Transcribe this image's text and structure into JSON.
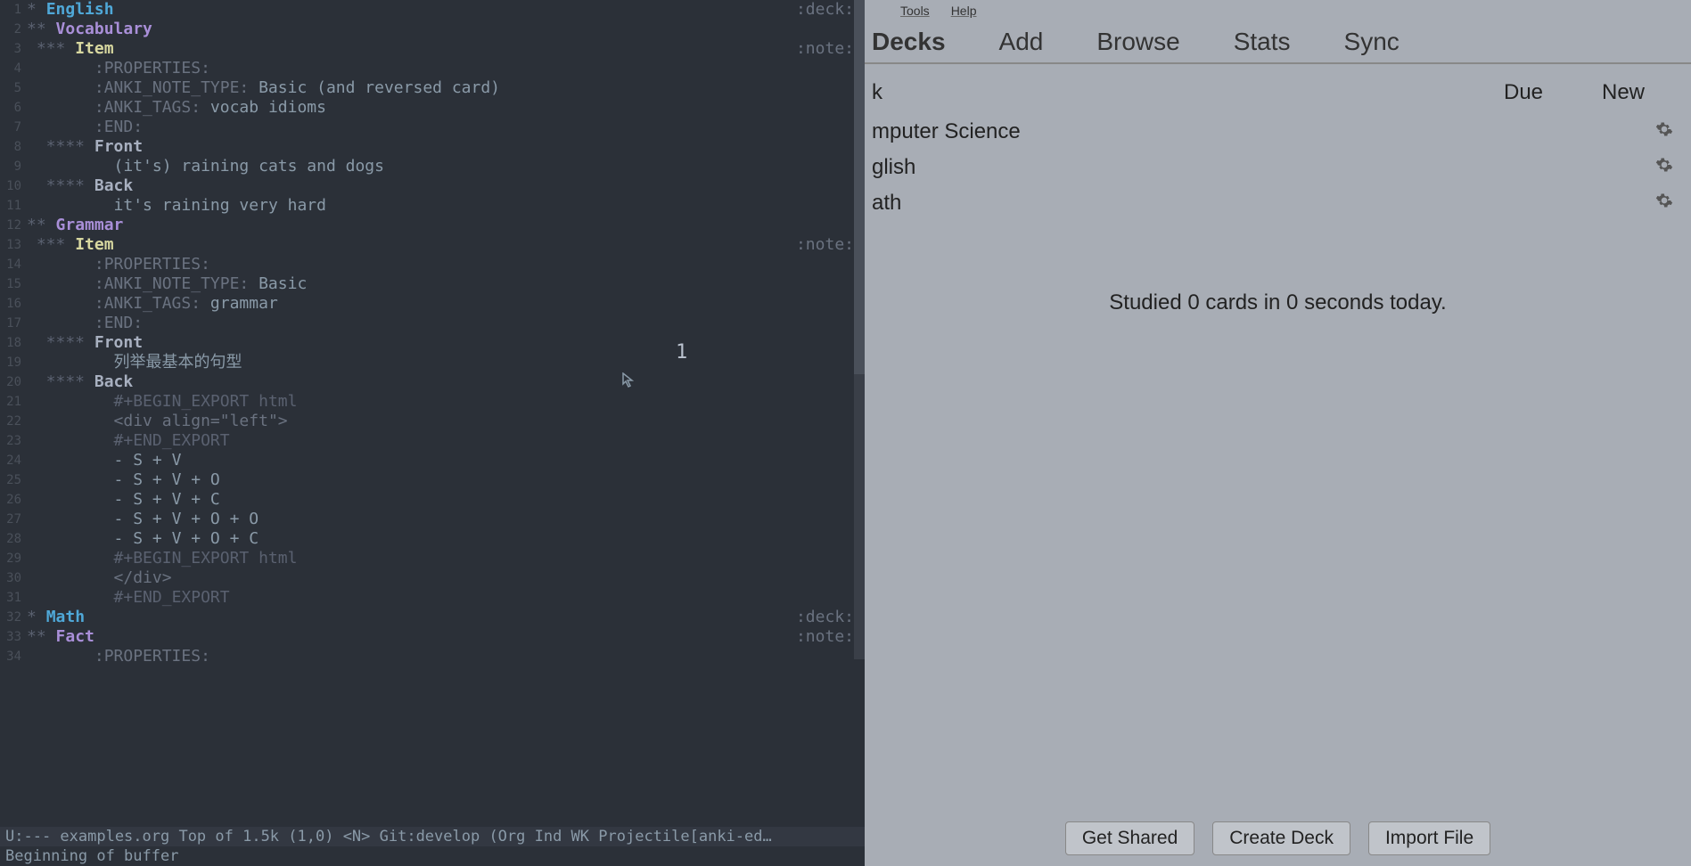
{
  "editor": {
    "lines": [
      {
        "n": "1",
        "stars": "*",
        "head": "English",
        "cls": "h1",
        "tag": ":deck:"
      },
      {
        "n": "2",
        "stars": "**",
        "head": "Vocabulary",
        "cls": "h2"
      },
      {
        "n": "3",
        "stars": "***",
        "head": "Item",
        "cls": "h3",
        "indent": " ",
        "tag": ":note:"
      },
      {
        "n": "4",
        "pkey": ":PROPERTIES:"
      },
      {
        "n": "5",
        "pkey": ":ANKI_NOTE_TYPE:",
        "pval": "Basic (and reversed card)"
      },
      {
        "n": "6",
        "pkey": ":ANKI_TAGS:",
        "pval": "vocab idioms"
      },
      {
        "n": "7",
        "pkey": ":END:"
      },
      {
        "n": "8",
        "stars": "****",
        "head": "Front",
        "cls": "h4",
        "indent": "  "
      },
      {
        "n": "9",
        "txt": "(it's) raining cats and dogs",
        "tind": "         "
      },
      {
        "n": "10",
        "stars": "****",
        "head": "Back",
        "cls": "h4",
        "indent": "  "
      },
      {
        "n": "11",
        "txt": "it's raining very hard",
        "tind": "         "
      },
      {
        "n": "12",
        "stars": "**",
        "head": "Grammar",
        "cls": "h2"
      },
      {
        "n": "13",
        "stars": "***",
        "head": "Item",
        "cls": "h3",
        "indent": " ",
        "tag": ":note:"
      },
      {
        "n": "14",
        "pkey": ":PROPERTIES:"
      },
      {
        "n": "15",
        "pkey": ":ANKI_NOTE_TYPE:",
        "pval": "Basic"
      },
      {
        "n": "16",
        "pkey": ":ANKI_TAGS:",
        "pval": "grammar"
      },
      {
        "n": "17",
        "pkey": ":END:"
      },
      {
        "n": "18",
        "stars": "****",
        "head": "Front",
        "cls": "h4",
        "indent": "  "
      },
      {
        "n": "19",
        "txt": "列举最基本的句型",
        "tind": "         "
      },
      {
        "n": "20",
        "stars": "****",
        "head": "Back",
        "cls": "h4",
        "indent": "  "
      },
      {
        "n": "21",
        "export": "#+BEGIN_EXPORT html",
        "tind": "         "
      },
      {
        "n": "22",
        "htmltag": "<div align=\"left\">",
        "tind": "         "
      },
      {
        "n": "23",
        "export": "#+END_EXPORT",
        "tind": "         "
      },
      {
        "n": "24",
        "txt": "- S + V",
        "tind": "         "
      },
      {
        "n": "25",
        "txt": "- S + V + O",
        "tind": "         "
      },
      {
        "n": "26",
        "txt": "- S + V + C",
        "tind": "         "
      },
      {
        "n": "27",
        "txt": "- S + V + O + O",
        "tind": "         "
      },
      {
        "n": "28",
        "txt": "- S + V + O + C",
        "tind": "         "
      },
      {
        "n": "29",
        "export": "#+BEGIN_EXPORT html",
        "tind": "         "
      },
      {
        "n": "30",
        "htmltag": "</div>",
        "tind": "         "
      },
      {
        "n": "31",
        "export": "#+END_EXPORT",
        "tind": "         "
      },
      {
        "n": "32",
        "stars": "*",
        "head": "Math",
        "cls": "h1",
        "tag": ":deck:"
      },
      {
        "n": "33",
        "stars": "**",
        "head": "Fact",
        "cls": "h2",
        "tag": ":note:"
      },
      {
        "n": "34",
        "pkey": ":PROPERTIES:",
        "partial": true
      }
    ],
    "overlay": "1",
    "modeline": "U:---  examples.org   Top of 1.5k (1,0)     <N>   Git:develop  (Org Ind WK Projectile[anki-ed…",
    "minibuf": "Beginning of buffer"
  },
  "anki": {
    "menu": {
      "tools": "Tools",
      "help": "Help"
    },
    "nav": {
      "decks": "Decks",
      "add": "Add",
      "browse": "Browse",
      "stats": "Stats",
      "sync": "Sync"
    },
    "header": {
      "deck": "k",
      "due": "Due",
      "new": "New"
    },
    "decks": [
      {
        "name": "mputer Science"
      },
      {
        "name": "glish"
      },
      {
        "name": "ath"
      }
    ],
    "stats": "Studied 0 cards in 0 seconds today.",
    "buttons": {
      "shared": "Get Shared",
      "create": "Create Deck",
      "import": "Import File"
    }
  }
}
